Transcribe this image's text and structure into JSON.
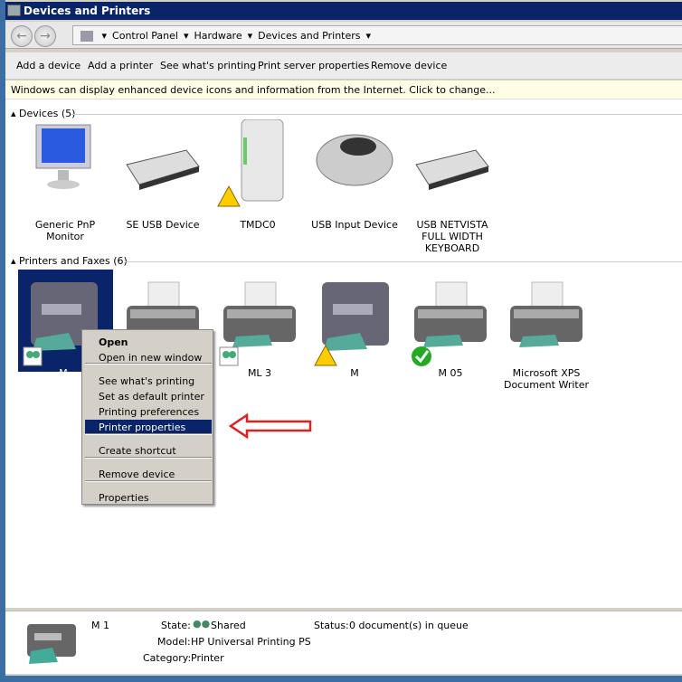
{
  "window": {
    "title": "Devices and Printers"
  },
  "breadcrumb": [
    "Control Panel",
    "Hardware",
    "Devices and Printers"
  ],
  "toolbar": [
    "Add a device",
    "Add a printer",
    "See what's printing",
    "Print server properties",
    "Remove device"
  ],
  "info_bar": "Windows can display enhanced device icons and information from the Internet. Click to change...",
  "devices": {
    "header": "Devices (5)",
    "items": [
      {
        "label": "Generic PnP Monitor",
        "icon": "monitor-icon"
      },
      {
        "label": "SE USB Device",
        "icon": "keyboard-icon"
      },
      {
        "label": "TMDC0",
        "icon": "tower-icon",
        "badge": "warning"
      },
      {
        "label": "USB Input Device",
        "icon": "mouse-icon"
      },
      {
        "label": "USB NETVISTA FULL WIDTH KEYBOARD",
        "icon": "keyboard-icon"
      }
    ]
  },
  "printers": {
    "header": "Printers and Faxes (6)",
    "items": [
      {
        "label": "M",
        "icon": "mfp-icon",
        "badge": "shared",
        "selected": true
      },
      {
        "label": "",
        "icon": "printer-icon"
      },
      {
        "label": "ML      3",
        "icon": "printer-icon",
        "badge": "shared"
      },
      {
        "label": "M",
        "icon": "mfp-icon",
        "badge": "warning"
      },
      {
        "label": "M     05",
        "icon": "printer-icon",
        "badge": "default"
      },
      {
        "label": "Microsoft XPS Document Writer",
        "icon": "printer-icon"
      }
    ]
  },
  "context_menu": {
    "items": [
      "Open",
      "Open in new window",
      "See what's printing",
      "Set as default printer",
      "Printing preferences",
      "Printer properties",
      "Create shortcut",
      "Remove device",
      "Properties"
    ],
    "highlighted": "Printer properties"
  },
  "details": {
    "name": "M      1",
    "state_label": "State:",
    "state": "Shared",
    "model_label": "Model:",
    "model": "HP Universal Printing PS",
    "category_label": "Category:",
    "category": "Printer",
    "status_label": "Status:",
    "status": "0 document(s) in queue"
  },
  "colors": {
    "title_bar": "#0a246a",
    "highlight": "#0a246a",
    "arrow": "#e02020",
    "info_bar": "#fffde5"
  }
}
